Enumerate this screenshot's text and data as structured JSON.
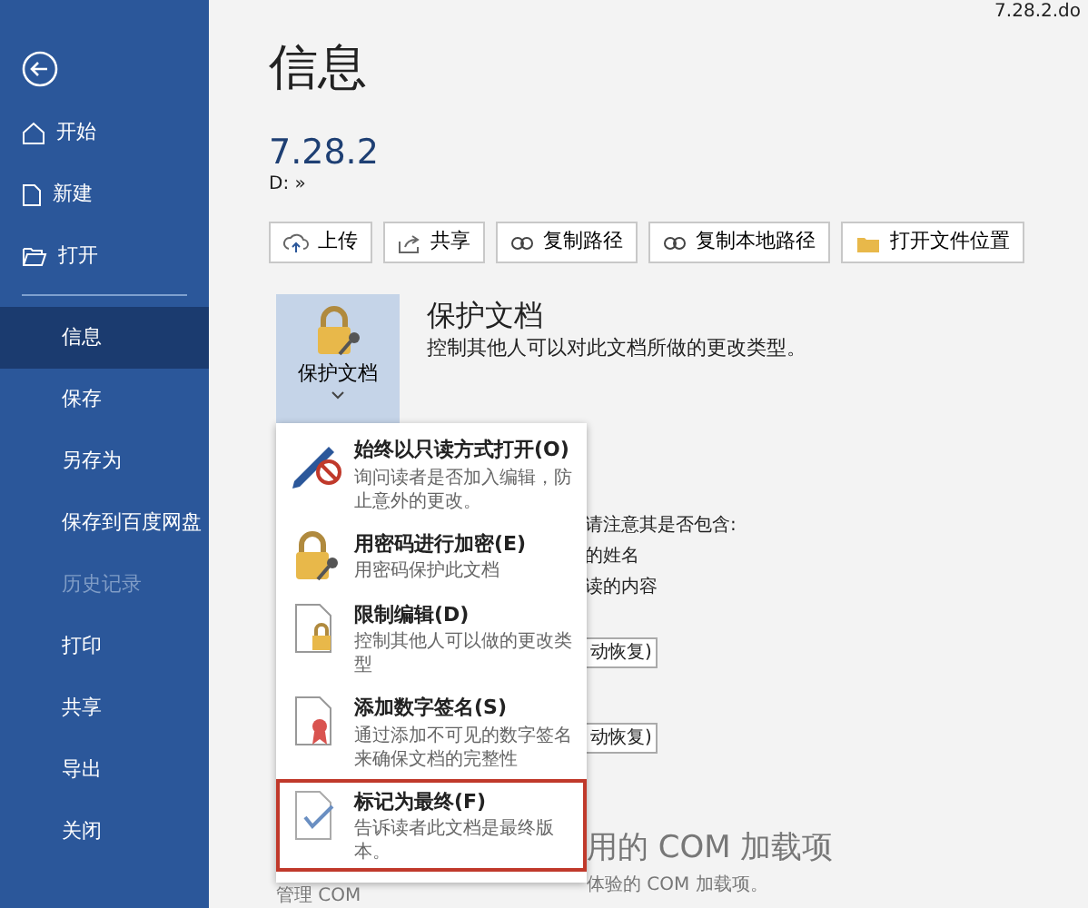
{
  "file_name": "7.28.2.do",
  "sidebar": {
    "top_items": [
      {
        "label": "开始"
      },
      {
        "label": "新建"
      },
      {
        "label": "打开"
      }
    ],
    "items": [
      {
        "label": "信息",
        "selected": true,
        "disabled": false
      },
      {
        "label": "保存",
        "selected": false,
        "disabled": false
      },
      {
        "label": "另存为",
        "selected": false,
        "disabled": false
      },
      {
        "label": "保存到百度网盘",
        "selected": false,
        "disabled": false
      },
      {
        "label": "历史记录",
        "selected": false,
        "disabled": true
      },
      {
        "label": "打印",
        "selected": false,
        "disabled": false
      },
      {
        "label": "共享",
        "selected": false,
        "disabled": false
      },
      {
        "label": "导出",
        "selected": false,
        "disabled": false
      },
      {
        "label": "关闭",
        "selected": false,
        "disabled": false
      }
    ]
  },
  "page_title": "信息",
  "document": {
    "name": "7.28.2",
    "path": "D: »"
  },
  "actions": [
    {
      "label": "上传"
    },
    {
      "label": "共享"
    },
    {
      "label": "复制路径"
    },
    {
      "label": "复制本地路径"
    },
    {
      "label": "打开文件位置"
    }
  ],
  "protect": {
    "button_label": "保护文档",
    "expanded": true,
    "title": "保护文档",
    "description": "控制其他人可以对此文档所做的更改类型。"
  },
  "protect_menu": [
    {
      "title": "始终以只读方式打开(O)",
      "description": "询问读者是否加入编辑，防止意外的更改。",
      "highlighted": false
    },
    {
      "title": "用密码进行加密(E)",
      "description": "用密码保护此文档",
      "highlighted": false
    },
    {
      "title": "限制编辑(D)",
      "description": "控制其他人可以做的更改类型",
      "highlighted": false
    },
    {
      "title": "添加数字签名(S)",
      "description": "通过添加不可见的数字签名来确保文档的完整性",
      "highlighted": false
    },
    {
      "title": "标记为最终(F)",
      "description": "告诉读者此文档是最终版本。",
      "highlighted": true
    }
  ],
  "inspect": {
    "lines": [
      "请注意其是否包含:",
      "的姓名",
      "读的内容"
    ]
  },
  "versions": [
    "动恢复)",
    "动恢复)"
  ],
  "com_addins": {
    "title": "用的 COM 加载项",
    "description": "体验的 COM 加载项。",
    "link": "管理 COM"
  }
}
